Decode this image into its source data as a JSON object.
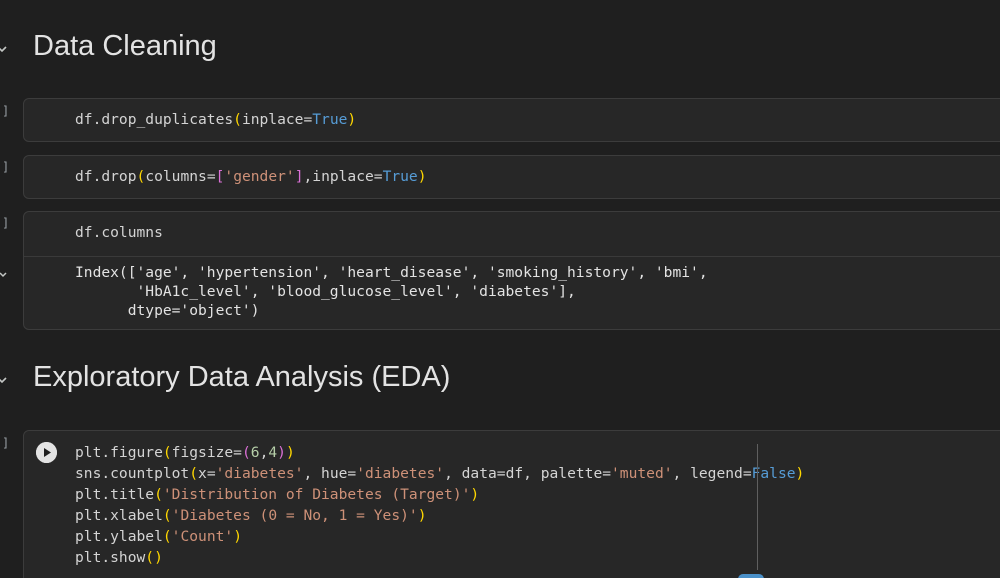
{
  "sections": {
    "cleaning": {
      "title": "Data Cleaning"
    },
    "eda": {
      "title": "Exploratory Data Analysis (EDA)"
    }
  },
  "exec_bracket": "]",
  "cells": {
    "drop_duplicates": {
      "tokens": {
        "prefix": "df.drop_duplicates",
        "open": "(",
        "arg": "inplace=",
        "value": "True",
        "close": ")"
      }
    },
    "drop_gender": {
      "tokens": {
        "prefix": "df.drop",
        "open": "(",
        "arg": "columns=",
        "lbr": "[",
        "str": "'gender'",
        "rbr": "]",
        "arg2": ",inplace=",
        "value": "True",
        "close": ")"
      }
    },
    "columns": {
      "code": "df.columns",
      "output": [
        "Index(['age', 'hypertension', 'heart_disease', 'smoking_history', 'bmi',",
        "       'HbA1c_level', 'blood_glucose_level', 'diabetes'],",
        "      dtype='object')"
      ]
    },
    "countplot": {
      "lines": [
        {
          "a": "plt.figure",
          "b": "(",
          "c": "figsize=",
          "d": "(",
          "e": "6",
          "f": ",",
          "g": "4",
          "h": ")",
          "i": ")"
        },
        {
          "a": "sns.countplot",
          "b": "(",
          "c": "x=",
          "d": "'diabetes'",
          "e": ", hue=",
          "f": "'diabetes'",
          "g": ", data=df, palette=",
          "h": "'muted'",
          "i": ", legend=",
          "j": "False",
          "k": ")"
        },
        {
          "a": "plt.title",
          "b": "(",
          "c": "'Distribution of Diabetes (Target)'",
          "d": ")"
        },
        {
          "a": "plt.xlabel",
          "b": "(",
          "c": "'Diabetes (0 = No, 1 = Yes)'",
          "d": ")"
        },
        {
          "a": "plt.ylabel",
          "b": "(",
          "c": "'Count'",
          "d": ")"
        },
        {
          "a": "plt.show",
          "b": "()"
        }
      ]
    }
  }
}
